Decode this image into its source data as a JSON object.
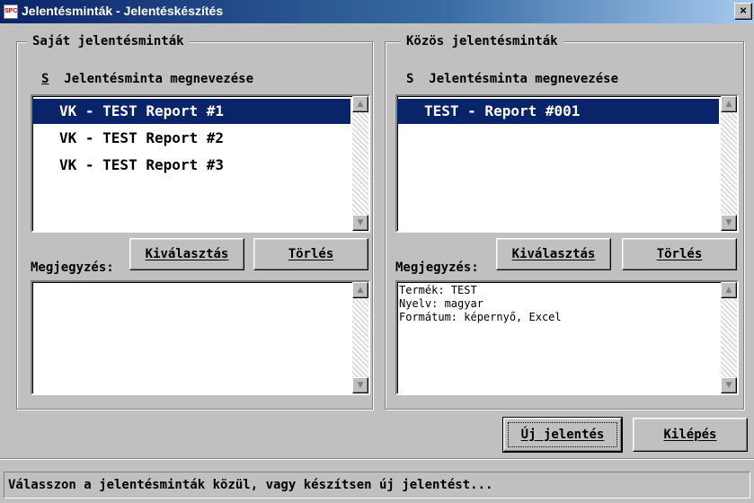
{
  "window": {
    "title": "Jelentésminták - Jelentéskészítés",
    "icon_text": "SPC",
    "close_glyph": "×"
  },
  "left": {
    "legend": "Saját jelentésminták",
    "col_prefix": "S",
    "col_header": "Jelentésminta megnevezése",
    "items": [
      {
        "label": "VK - TEST Report #1",
        "selected": true
      },
      {
        "label": "VK - TEST Report #2",
        "selected": false
      },
      {
        "label": "VK - TEST Report #3",
        "selected": false
      }
    ],
    "note_label": "Megjegyzés:",
    "select_button": "Kiválasztás",
    "delete_button": "Törlés",
    "note_text": ""
  },
  "right": {
    "legend": "Közös jelentésminták",
    "col_prefix": "S",
    "col_header": "Jelentésminta megnevezése",
    "items": [
      {
        "label": "TEST - Report #001",
        "selected": true
      }
    ],
    "note_label": "Megjegyzés:",
    "select_button": "Kiválasztás",
    "delete_button": "Törlés",
    "note_text": "Termék: TEST\nNyelv: magyar\nFormátum: képernyő, Excel"
  },
  "footer": {
    "new_report_button": "Új jelentés",
    "exit_button": "Kilépés"
  },
  "status": {
    "text": "Válasszon a jelentésminták közül, vagy készítsen új jelentést..."
  },
  "icons": {
    "scroll_up": "▲",
    "scroll_down": "▼"
  }
}
